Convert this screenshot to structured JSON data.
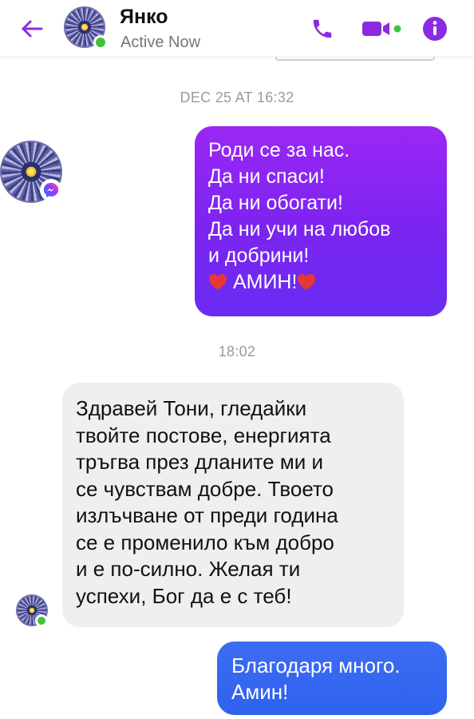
{
  "header": {
    "contact_name": "Янко",
    "status": "Active Now",
    "accent_color": "#8a2be2",
    "icons": [
      "back-arrow-icon",
      "phone-icon",
      "video-camera-icon",
      "info-icon"
    ]
  },
  "conversation": {
    "timestamp_1": "DEC 25 AT 16:32",
    "timestamp_2": "18:02",
    "messages": [
      {
        "direction": "sent",
        "color": "#8a2be2",
        "lines": [
          "Роди се за нас.",
          "Да ни спаси!",
          "Да ни обогати!",
          "Да ни учи на любов",
          "и добрини!",
          "АМИН!"
        ]
      },
      {
        "direction": "received",
        "color": "#efeff1",
        "lines": [
          "Здравей Тони, гледайки",
          "твойте постове, енергията",
          "тръгва през дланите ми и",
          "се чувствам добре. Твоето",
          "излъчване от преди година",
          "се е променило към добро",
          "и е по-силно. Желая ти",
          "успехи, Бог да е с теб!"
        ]
      },
      {
        "direction": "sent",
        "color": "#3468f0",
        "lines": [
          "Благодаря много.",
          "Амин!"
        ]
      }
    ]
  }
}
